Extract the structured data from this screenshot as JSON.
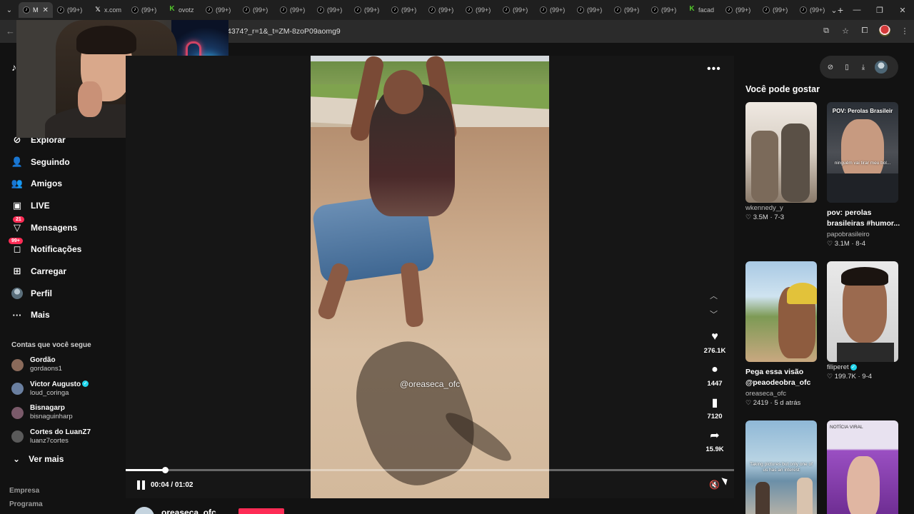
{
  "tabs": [
    {
      "label": "M",
      "icon": "tiktok",
      "active": true
    },
    {
      "label": "(99+)",
      "icon": "tiktok"
    },
    {
      "label": "x.com",
      "icon": "x"
    },
    {
      "label": "(99+)",
      "icon": "tiktok"
    },
    {
      "label": "ovotz",
      "icon": "kick"
    },
    {
      "label": "(99+)",
      "icon": "tiktok"
    },
    {
      "label": "(99+)",
      "icon": "tiktok"
    },
    {
      "label": "(99+)",
      "icon": "tiktok"
    },
    {
      "label": "(99+)",
      "icon": "tiktok"
    },
    {
      "label": "(99+)",
      "icon": "tiktok"
    },
    {
      "label": "(99+)",
      "icon": "tiktok"
    },
    {
      "label": "(99+)",
      "icon": "tiktok"
    },
    {
      "label": "(99+)",
      "icon": "tiktok"
    },
    {
      "label": "(99+)",
      "icon": "tiktok"
    },
    {
      "label": "(99+)",
      "icon": "tiktok"
    },
    {
      "label": "(99+)",
      "icon": "tiktok"
    },
    {
      "label": "(99+)",
      "icon": "tiktok"
    },
    {
      "label": "(99+)",
      "icon": "tiktok"
    },
    {
      "label": "facad",
      "icon": "kick"
    },
    {
      "label": "(99+)",
      "icon": "tiktok"
    },
    {
      "label": "(99+)",
      "icon": "tiktok"
    },
    {
      "label": "(99+)",
      "icon": "tiktok"
    }
  ],
  "address": {
    "url": "4374?_r=1&_t=ZM-8zoP09aomg9"
  },
  "nav": {
    "explorar": "Explorar",
    "seguindo": "Seguindo",
    "amigos": "Amigos",
    "live": "LIVE",
    "mensagens": "Mensagens",
    "mensagens_badge": "21",
    "notificacoes": "Notificações",
    "notificacoes_badge": "99+",
    "carregar": "Carregar",
    "perfil": "Perfil",
    "mais": "Mais"
  },
  "following": {
    "title": "Contas que você segue",
    "accounts": [
      {
        "name": "Gordão",
        "handle": "gordaons1",
        "verified": false
      },
      {
        "name": "Victor Augusto",
        "handle": "loud_coringa",
        "verified": true
      },
      {
        "name": "Bisnagarp",
        "handle": "bisnaguinharp",
        "verified": false
      },
      {
        "name": "Cortes do LuanZ7",
        "handle": "luanz7cortes",
        "verified": false
      }
    ],
    "see_more": "Ver mais"
  },
  "footer": {
    "empresa": "Empresa",
    "programa": "Programa"
  },
  "video": {
    "watermark": "@oreaseca_ofc",
    "likes": "276.1K",
    "comments": "1447",
    "saves": "7120",
    "shares": "15.9K",
    "time_current": "00:04",
    "time_total": "01:02",
    "timecode": "00:04 / 01:02",
    "progress": 0.065,
    "author": "oreaseca_ofc"
  },
  "recommendations": {
    "title": "Você pode gostar",
    "items": [
      {
        "title": "",
        "author": "wkennedy_y",
        "likes": "3.5M",
        "date": "7-3",
        "thumb_label": "",
        "overlay": ""
      },
      {
        "title": "pov: perolas brasileiras #humor...",
        "author": "papobrasileiro",
        "likes": "3.1M",
        "date": "8-4",
        "thumb_label": "POV: Perolas Brasileir",
        "overlay": "ninguém vai tirar meu bol..."
      },
      {
        "title": "Pega essa visão @peaodeobra_ofc",
        "author": "oreaseca_ofc",
        "likes": "2419",
        "date": "5 d atrás",
        "thumb_label": "",
        "overlay": ""
      },
      {
        "title": "",
        "author": "filiperet",
        "likes": "199.7K",
        "date": "9-4",
        "thumb_label": "",
        "overlay": "",
        "verified": true
      },
      {
        "title": "",
        "author": "",
        "likes": "",
        "date": "",
        "thumb_label": "",
        "overlay": "Taking pictures but only one of us has an interest"
      },
      {
        "title": "",
        "author": "",
        "likes": "",
        "date": "",
        "thumb_label": "",
        "overlay": "NOTÍCIA VIRAL"
      }
    ]
  },
  "colors": {
    "accent": "#fe2c55",
    "verified": "#20d5ec",
    "bg": "#121212"
  }
}
